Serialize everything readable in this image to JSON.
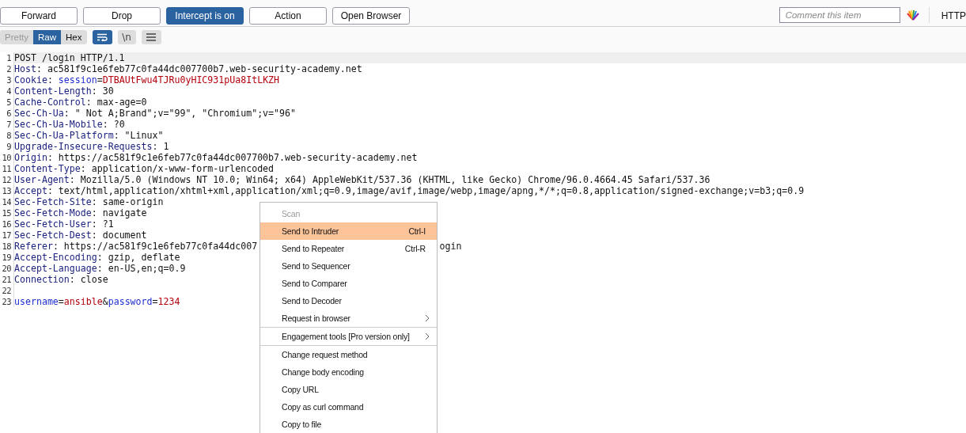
{
  "toolbar": {
    "buttons": [
      {
        "label": "Forward",
        "selected": false
      },
      {
        "label": "Drop",
        "selected": false
      },
      {
        "label": "Intercept is on",
        "selected": true
      },
      {
        "label": "Action",
        "selected": false
      },
      {
        "label": "Open Browser",
        "selected": false
      }
    ],
    "comment": {
      "placeholder": "Comment this item"
    },
    "tab_label": "HTTP"
  },
  "view_tabs": [
    {
      "label": "Pretty",
      "selected": false
    },
    {
      "label": "Raw",
      "selected": true
    },
    {
      "label": "Hex",
      "selected": false
    }
  ],
  "view_toggles": [
    {
      "kind": "wrap",
      "on": true
    },
    {
      "kind": "newline",
      "label": "\\n",
      "on": false
    },
    {
      "kind": "menu",
      "on": false
    }
  ],
  "editor": {
    "lines": [
      {
        "number": "1",
        "current": true,
        "tokens": [
          {
            "kind": "plain",
            "text": "POST /login HTTP/1.1"
          }
        ]
      },
      {
        "number": "2",
        "current": false,
        "tokens": [
          {
            "kind": "header",
            "text": "Host"
          },
          {
            "kind": "plain",
            "text": ": ac581f9c1e6feb77c0fa44dc007700b7.web-security-academy.net"
          }
        ]
      },
      {
        "number": "3",
        "current": false,
        "tokens": [
          {
            "kind": "header",
            "text": "Cookie"
          },
          {
            "kind": "plain",
            "text": ": "
          },
          {
            "kind": "param",
            "text": "session"
          },
          {
            "kind": "plain",
            "text": "="
          },
          {
            "kind": "value",
            "text": "DTBAUtFwu4TJRu0yHIC931pUa8ItLKZH"
          }
        ]
      },
      {
        "number": "4",
        "current": false,
        "tokens": [
          {
            "kind": "header",
            "text": "Content-Length"
          },
          {
            "kind": "plain",
            "text": ": 30"
          }
        ]
      },
      {
        "number": "5",
        "current": false,
        "tokens": [
          {
            "kind": "header",
            "text": "Cache-Control"
          },
          {
            "kind": "plain",
            "text": ": max-age=0"
          }
        ]
      },
      {
        "number": "6",
        "current": false,
        "tokens": [
          {
            "kind": "header",
            "text": "Sec-Ch-Ua"
          },
          {
            "kind": "plain",
            "text": ": \" Not A;Brand\";v=\"99\", \"Chromium\";v=\"96\""
          }
        ]
      },
      {
        "number": "7",
        "current": false,
        "tokens": [
          {
            "kind": "header",
            "text": "Sec-Ch-Ua-Mobile"
          },
          {
            "kind": "plain",
            "text": ": ?0"
          }
        ]
      },
      {
        "number": "8",
        "current": false,
        "tokens": [
          {
            "kind": "header",
            "text": "Sec-Ch-Ua-Platform"
          },
          {
            "kind": "plain",
            "text": ": \"Linux\""
          }
        ]
      },
      {
        "number": "9",
        "current": false,
        "tokens": [
          {
            "kind": "header",
            "text": "Upgrade-Insecure-Requests"
          },
          {
            "kind": "plain",
            "text": ": 1"
          }
        ]
      },
      {
        "number": "10",
        "current": false,
        "tokens": [
          {
            "kind": "header",
            "text": "Origin"
          },
          {
            "kind": "plain",
            "text": ": https://ac581f9c1e6feb77c0fa44dc007700b7.web-security-academy.net"
          }
        ]
      },
      {
        "number": "11",
        "current": false,
        "tokens": [
          {
            "kind": "header",
            "text": "Content-Type"
          },
          {
            "kind": "plain",
            "text": ": application/x-www-form-urlencoded"
          }
        ]
      },
      {
        "number": "12",
        "current": false,
        "tokens": [
          {
            "kind": "header",
            "text": "User-Agent"
          },
          {
            "kind": "plain",
            "text": ": Mozilla/5.0 (Windows NT 10.0; Win64; x64) AppleWebKit/537.36 (KHTML, like Gecko) Chrome/96.0.4664.45 Safari/537.36"
          }
        ]
      },
      {
        "number": "13",
        "current": false,
        "tokens": [
          {
            "kind": "header",
            "text": "Accept"
          },
          {
            "kind": "plain",
            "text": ": text/html,application/xhtml+xml,application/xml;q=0.9,image/avif,image/webp,image/apng,*/*;q=0.8,application/signed-exchange;v=b3;q=0.9"
          }
        ]
      },
      {
        "number": "14",
        "current": false,
        "tokens": [
          {
            "kind": "header",
            "text": "Sec-Fetch-Site"
          },
          {
            "kind": "plain",
            "text": ": same-origin"
          }
        ]
      },
      {
        "number": "15",
        "current": false,
        "tokens": [
          {
            "kind": "header",
            "text": "Sec-Fetch-Mode"
          },
          {
            "kind": "plain",
            "text": ": navigate"
          }
        ]
      },
      {
        "number": "16",
        "current": false,
        "tokens": [
          {
            "kind": "header",
            "text": "Sec-Fetch-User"
          },
          {
            "kind": "plain",
            "text": ": ?1"
          }
        ]
      },
      {
        "number": "17",
        "current": false,
        "tokens": [
          {
            "kind": "header",
            "text": "Sec-Fetch-Dest"
          },
          {
            "kind": "plain",
            "text": ": document"
          }
        ]
      },
      {
        "number": "18",
        "current": false,
        "tokens": [
          {
            "kind": "header",
            "text": "Referer"
          },
          {
            "kind": "plain",
            "text": ": https://ac581f9c1e6feb77c0fa44dc007"
          },
          {
            "kind": "after_menu",
            "text": "ogin"
          }
        ]
      },
      {
        "number": "19",
        "current": false,
        "tokens": [
          {
            "kind": "header",
            "text": "Accept-Encoding"
          },
          {
            "kind": "plain",
            "text": ": gzip, deflate"
          }
        ]
      },
      {
        "number": "20",
        "current": false,
        "tokens": [
          {
            "kind": "header",
            "text": "Accept-Language"
          },
          {
            "kind": "plain",
            "text": ": en-US,en;q=0.9"
          }
        ]
      },
      {
        "number": "21",
        "current": false,
        "tokens": [
          {
            "kind": "header",
            "text": "Connection"
          },
          {
            "kind": "plain",
            "text": ": close"
          }
        ]
      },
      {
        "number": "22",
        "current": false
      },
      {
        "number": "23",
        "current": false,
        "tokens": [
          {
            "kind": "param",
            "text": "username"
          },
          {
            "kind": "plain",
            "text": "="
          },
          {
            "kind": "value",
            "text": "ansible"
          },
          {
            "kind": "plain",
            "text": "&"
          },
          {
            "kind": "param",
            "text": "password"
          },
          {
            "kind": "plain",
            "text": "="
          },
          {
            "kind": "value",
            "text": "1234"
          }
        ]
      }
    ]
  },
  "context_menu": {
    "groups": [
      [
        {
          "label": "Scan",
          "disabled": true,
          "selected": false
        },
        {
          "label": "Send to Intruder",
          "shortcut": "Ctrl-I",
          "disabled": false,
          "selected": true
        },
        {
          "label": "Send to Repeater",
          "shortcut": "Ctrl-R",
          "disabled": false,
          "selected": false
        },
        {
          "label": "Send to Sequencer",
          "disabled": false,
          "selected": false
        },
        {
          "label": "Send to Comparer",
          "disabled": false,
          "selected": false
        },
        {
          "label": "Send to Decoder",
          "disabled": false,
          "selected": false
        },
        {
          "label": "Request in browser",
          "submenu": true,
          "disabled": false,
          "selected": false
        }
      ],
      [
        {
          "label": "Engagement tools [Pro version only]",
          "submenu": true,
          "disabled": false,
          "selected": false
        }
      ],
      [
        {
          "label": "Change request method",
          "disabled": false,
          "selected": false
        },
        {
          "label": "Change body encoding",
          "disabled": false,
          "selected": false
        },
        {
          "label": "Copy URL",
          "disabled": false,
          "selected": false
        },
        {
          "label": "Copy as curl command",
          "disabled": false,
          "selected": false
        },
        {
          "label": "Copy to file",
          "disabled": false,
          "selected": false
        }
      ]
    ]
  }
}
